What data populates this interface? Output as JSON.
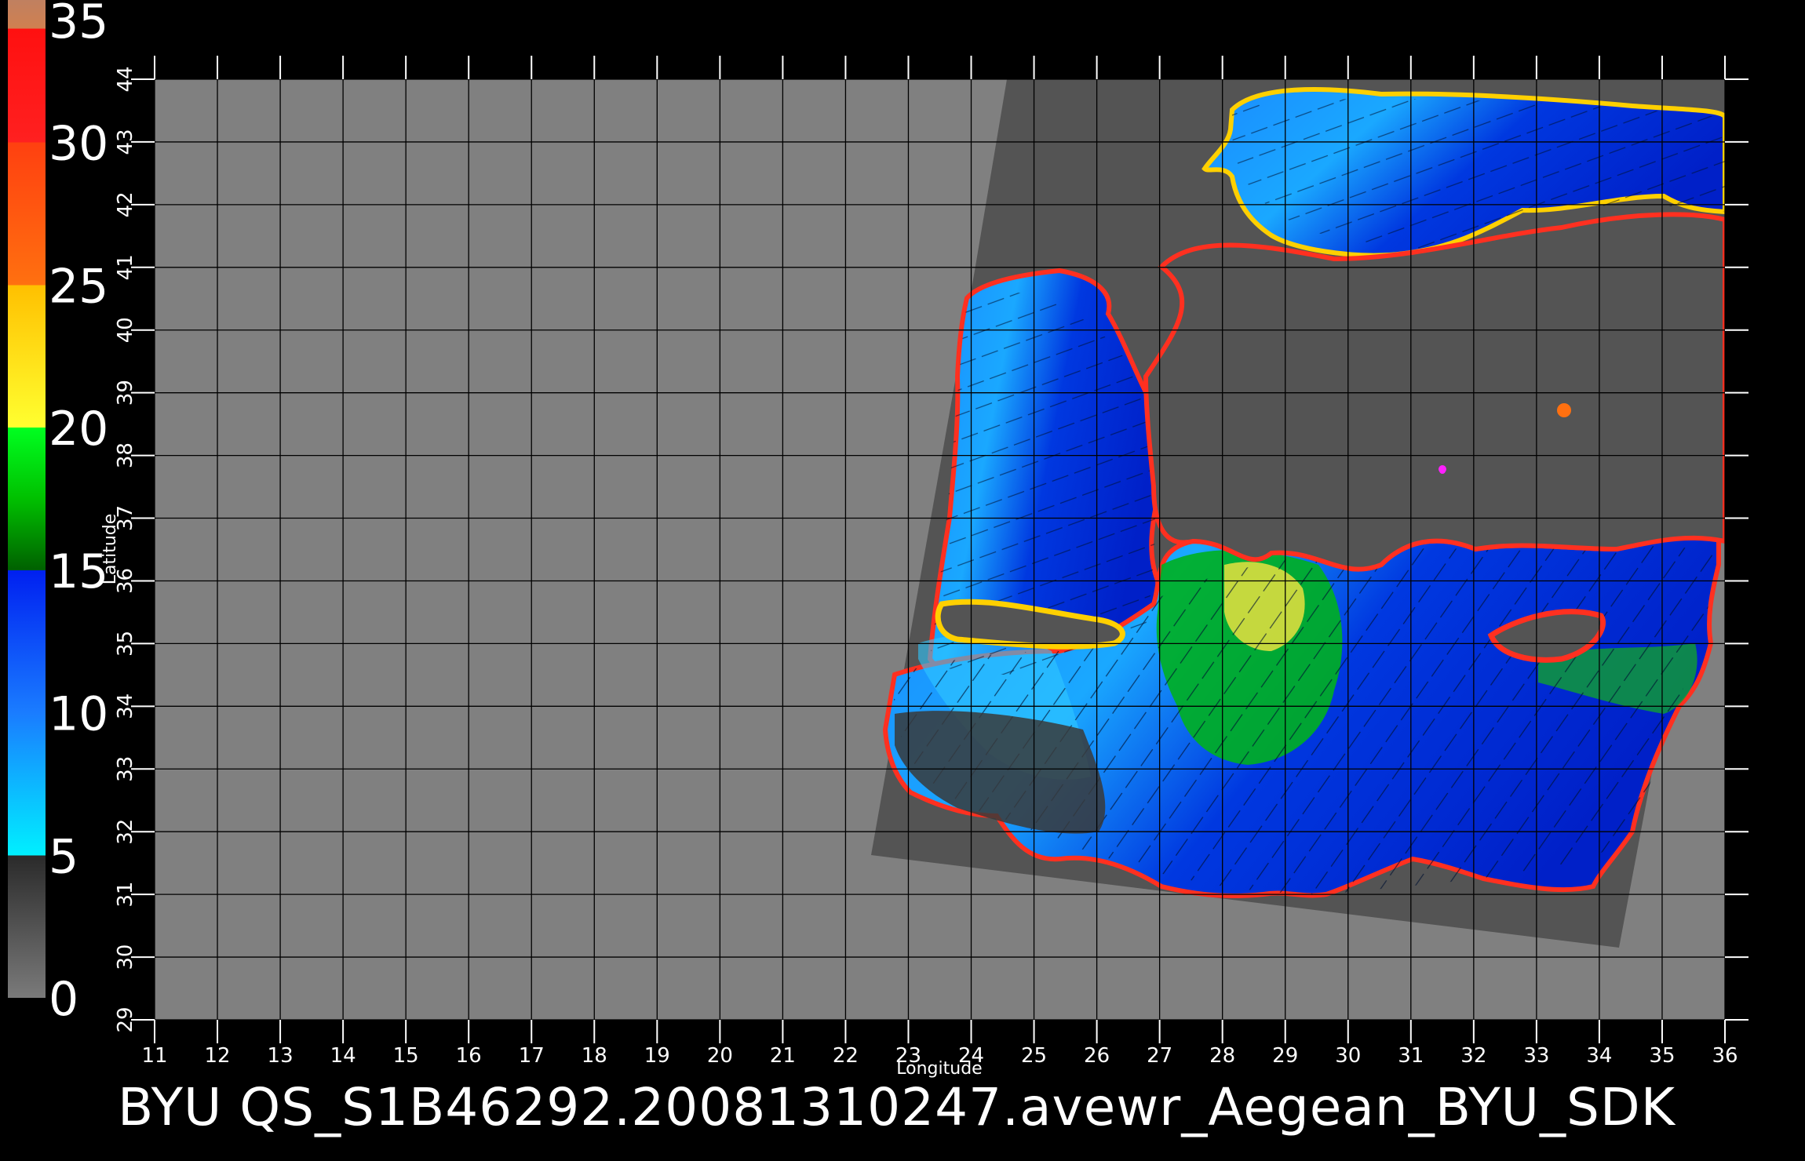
{
  "caption": "BYU  QS_S1B46292.20081310247.avewr_Aegean_BYU_SDK",
  "axes": {
    "xlabel": "Longitude",
    "ylabel": "Latitude",
    "x_range": [
      11,
      36
    ],
    "y_range": [
      29,
      44
    ],
    "x_ticks": [
      "11",
      "12",
      "13",
      "14",
      "15",
      "16",
      "17",
      "18",
      "19",
      "20",
      "21",
      "22",
      "23",
      "24",
      "25",
      "26",
      "27",
      "28",
      "29",
      "30",
      "31",
      "32",
      "33",
      "34",
      "35",
      "36"
    ],
    "y_ticks": [
      "29",
      "30",
      "31",
      "32",
      "33",
      "34",
      "35",
      "36",
      "37",
      "38",
      "39",
      "40",
      "41",
      "42",
      "43",
      "44"
    ]
  },
  "color_scale": {
    "labels": [
      "0",
      "5",
      "10",
      "15",
      "20",
      "25",
      "30",
      "35"
    ],
    "min": 0,
    "max": 35,
    "stops": [
      {
        "value": 0,
        "color": "#7a7a7a"
      },
      {
        "value": 5,
        "color": "#2a2a2a"
      },
      {
        "value": 5,
        "color": "#00f0ff"
      },
      {
        "value": 10,
        "color": "#1a7cff"
      },
      {
        "value": 15,
        "color": "#0020f0"
      },
      {
        "value": 15,
        "color": "#006000"
      },
      {
        "value": 17.5,
        "color": "#00c000"
      },
      {
        "value": 20,
        "color": "#00ff20"
      },
      {
        "value": 20,
        "color": "#ffff30"
      },
      {
        "value": 25,
        "color": "#ffc000"
      },
      {
        "value": 25,
        "color": "#ff7010"
      },
      {
        "value": 30,
        "color": "#ff4010"
      },
      {
        "value": 30,
        "color": "#ff2020"
      },
      {
        "value": 34,
        "color": "#ff1010"
      },
      {
        "value": 34,
        "color": "#d08050"
      },
      {
        "value": 35,
        "color": "#c08060"
      }
    ]
  },
  "colors": {
    "background": "#000000",
    "map_gray": "#808080",
    "swath_gray": "#545454",
    "grid": "#000000"
  }
}
